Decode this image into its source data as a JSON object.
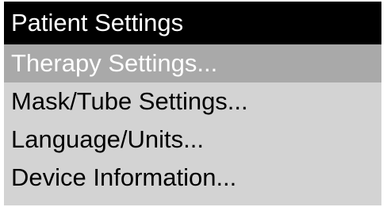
{
  "header": {
    "title": "Patient Settings"
  },
  "menu": {
    "selected_index": 0,
    "items": [
      {
        "label": "Therapy Settings..."
      },
      {
        "label": "Mask/Tube Settings..."
      },
      {
        "label": "Language/Units..."
      },
      {
        "label": "Device Information..."
      }
    ]
  },
  "colors": {
    "header_bg": "#000000",
    "header_text": "#ffffff",
    "menu_bg": "#d3d3d3",
    "selected_bg": "#a9a9a9",
    "selected_text": "#ffffff",
    "item_text": "#000000"
  }
}
